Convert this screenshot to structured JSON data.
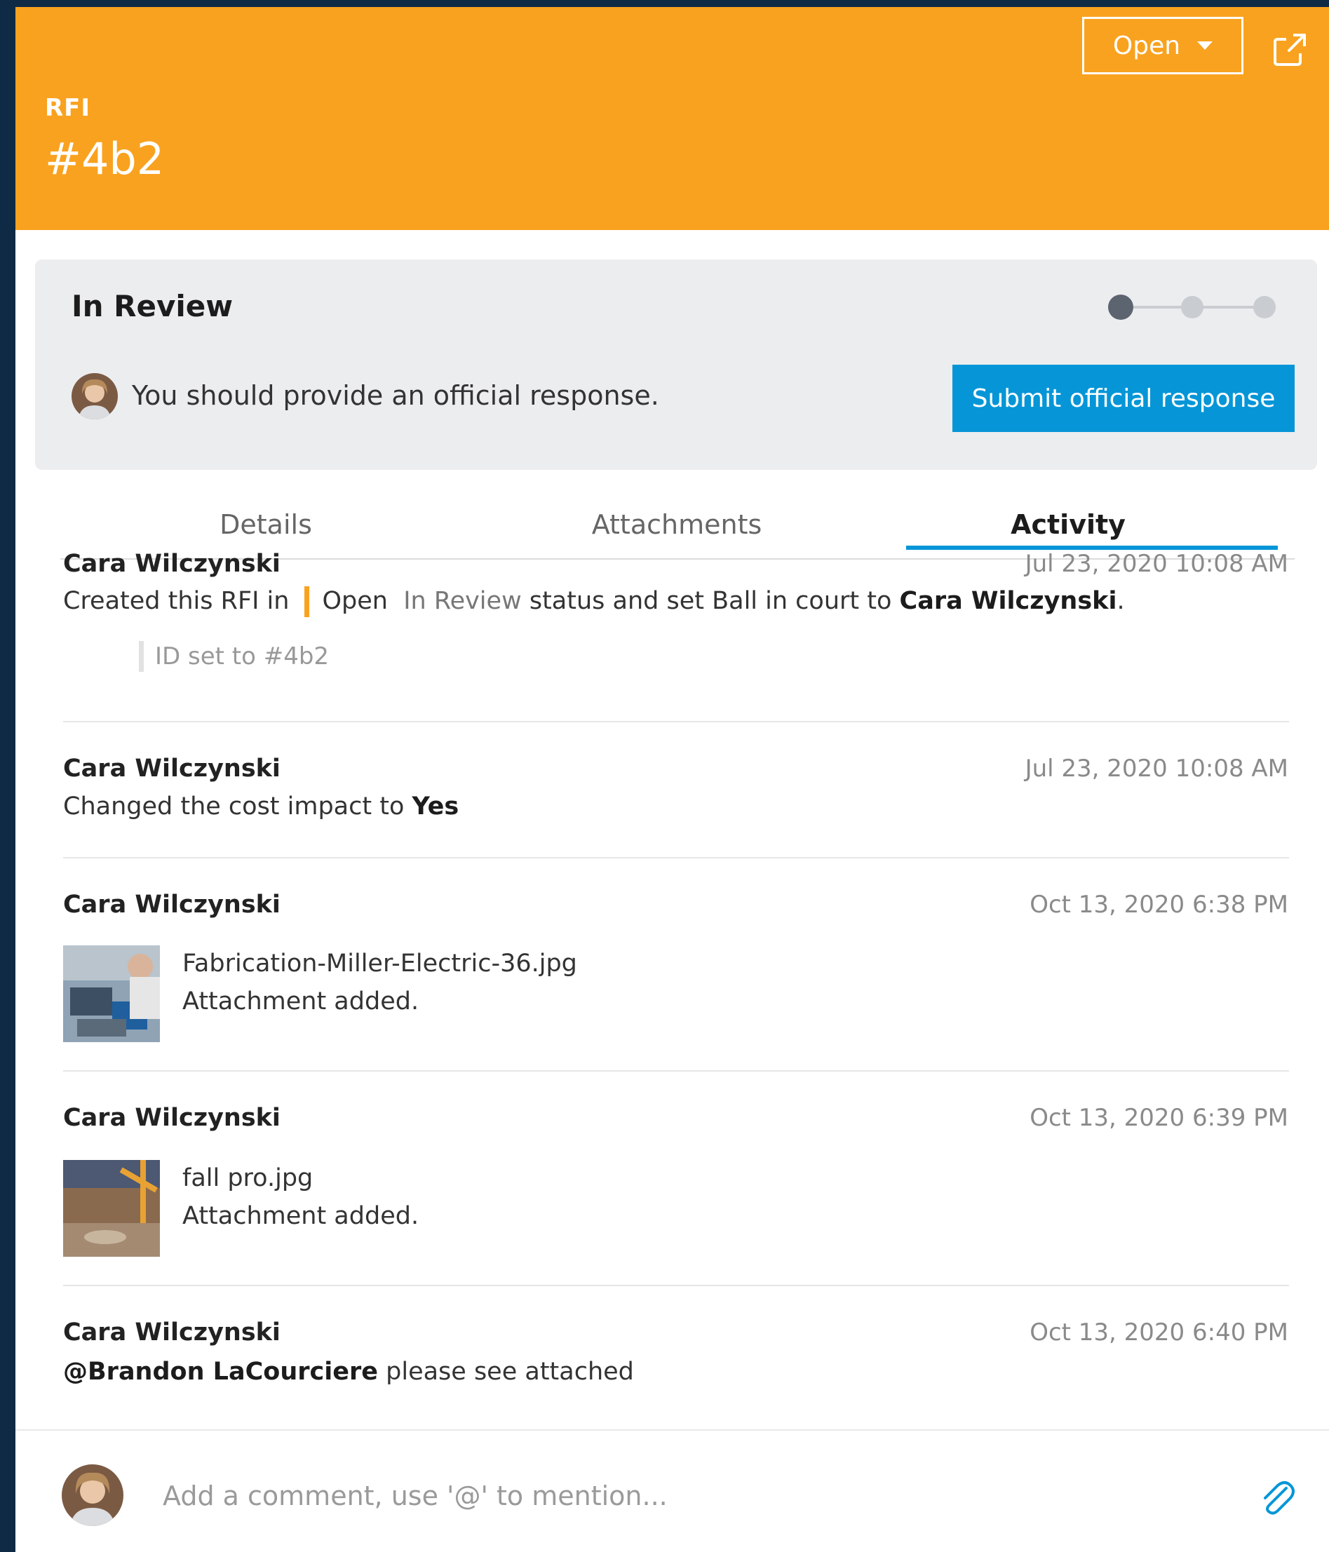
{
  "header": {
    "type_label": "RFI",
    "rfi_id": "#4b2",
    "status_button": "Open",
    "share_icon": "share-icon"
  },
  "review": {
    "title": "In Review",
    "progress_steps": 3,
    "progress_current": 1,
    "message": "You should provide an official response.",
    "submit_label": "Submit official response"
  },
  "tabs": [
    {
      "label": "Details",
      "active": false
    },
    {
      "label": "Attachments",
      "active": false
    },
    {
      "label": "Activity",
      "active": true
    }
  ],
  "activity": [
    {
      "name": "Cara Wilczynski",
      "date": "Jul 23, 2020 10:08 AM",
      "prefix": "Created this RFI in",
      "status_from": "Open",
      "status_to": "In Review",
      "mid": "status and set Ball in court to",
      "assignee": "Cara Wilczynski",
      "suffix": ".",
      "detail": "ID set to #4b2"
    },
    {
      "name": "Cara Wilczynski",
      "date": "Jul 23, 2020 10:08 AM",
      "prefix": "Changed the cost impact to",
      "value": "Yes"
    },
    {
      "name": "Cara Wilczynski",
      "date": "Oct 13, 2020 6:38 PM",
      "file": "Fabrication-Miller-Electric-36.jpg",
      "note": "Attachment added."
    },
    {
      "name": "Cara Wilczynski",
      "date": "Oct 13, 2020 6:39 PM",
      "file": "fall pro.jpg",
      "note": "Attachment added."
    },
    {
      "name": "Cara Wilczynski",
      "date": "Oct 13, 2020 6:40 PM",
      "mention": "@Brandon LaCourciere",
      "text": "please see attached"
    }
  ],
  "comment": {
    "placeholder": "Add a comment, use '@' to mention..."
  },
  "colors": {
    "header": "#f9a21f",
    "accent": "#0696d7",
    "card": "#ecedef",
    "frame": "#0f2a45"
  }
}
